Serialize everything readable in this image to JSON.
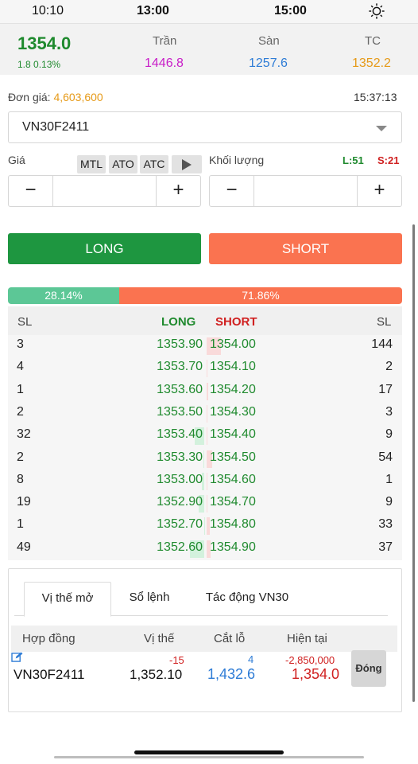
{
  "timebar": {
    "time_1": "10:10",
    "time_2": "13:00",
    "time_3": "15:00",
    "settings_icon": "gear-icon"
  },
  "price_header": {
    "current_price": "1354.0",
    "change": "1.8 0.13%",
    "ceiling_label": "Trần",
    "ceiling_value": "1446.8",
    "floor_label": "Sàn",
    "floor_value": "1257.6",
    "reference_label": "TC",
    "reference_value": "1352.2",
    "colors": {
      "up": "#1f8a2e",
      "ceiling": "#c81ec8",
      "floor": "#2e7cd6",
      "reference": "#e69a18"
    }
  },
  "order": {
    "unit_price_label": "Đơn giá:",
    "unit_price_value": "4,603,600",
    "clock": "15:37:13",
    "contract": "VN30F2411",
    "price_label": "Giá",
    "order_types": [
      "MTL",
      "ATO",
      "ATC"
    ],
    "play_icon": "play-icon",
    "qty_label": "Khối lượng",
    "long_limit": "L:51",
    "short_limit": "S:21",
    "minus": "−",
    "plus": "+",
    "price_value": "",
    "qty_value": "",
    "long_button": "LONG",
    "short_button": "SHORT",
    "colors": {
      "long": "#1e9640",
      "short": "#fa7350"
    }
  },
  "ratio": {
    "long_pct": "28.14%",
    "short_pct": "71.86%",
    "long_fraction": 0.2814
  },
  "orderbook": {
    "headers": {
      "qty_left": "SL",
      "long": "LONG",
      "short": "SHORT",
      "qty_right": "SL"
    },
    "rows": [
      {
        "bid_qty": "3",
        "bid_price": "1353.90",
        "ask_price": "1354.00",
        "ask_qty": "144",
        "bid_level": 0.0,
        "ask_level": 1.0
      },
      {
        "bid_qty": "4",
        "bid_price": "1353.70",
        "ask_price": "1354.10",
        "ask_qty": "2",
        "bid_level": 0.0,
        "ask_level": 0.05
      },
      {
        "bid_qty": "1",
        "bid_price": "1353.60",
        "ask_price": "1354.20",
        "ask_qty": "17",
        "bid_level": 0.0,
        "ask_level": 0.12
      },
      {
        "bid_qty": "2",
        "bid_price": "1353.50",
        "ask_price": "1354.30",
        "ask_qty": "3",
        "bid_level": 0.0,
        "ask_level": 0.05
      },
      {
        "bid_qty": "32",
        "bid_price": "1353.40",
        "ask_price": "1354.40",
        "ask_qty": "9",
        "bid_level": 0.65,
        "ask_level": 0.06
      },
      {
        "bid_qty": "2",
        "bid_price": "1353.30",
        "ask_price": "1354.50",
        "ask_qty": "54",
        "bid_level": 0.05,
        "ask_level": 0.38
      },
      {
        "bid_qty": "8",
        "bid_price": "1353.00",
        "ask_price": "1354.60",
        "ask_qty": "1",
        "bid_level": 0.16,
        "ask_level": 0.02
      },
      {
        "bid_qty": "19",
        "bid_price": "1352.90",
        "ask_price": "1354.70",
        "ask_qty": "9",
        "bid_level": 0.39,
        "ask_level": 0.06
      },
      {
        "bid_qty": "1",
        "bid_price": "1352.70",
        "ask_price": "1354.80",
        "ask_qty": "33",
        "bid_level": 0.02,
        "ask_level": 0.23
      },
      {
        "bid_qty": "49",
        "bid_price": "1352.60",
        "ask_price": "1354.90",
        "ask_qty": "37",
        "bid_level": 1.0,
        "ask_level": 0.26
      }
    ]
  },
  "positions": {
    "tabs": [
      "Vị thế mở",
      "Sổ lệnh",
      "Tác động VN30"
    ],
    "active_tab": 0,
    "headers": {
      "contract": "Hợp đồng",
      "position": "Vị thế",
      "cut_loss": "Cắt lỗ",
      "current": "Hiện tại"
    },
    "row": {
      "contract": "VN30F2411",
      "qty": "-15",
      "price": "1,352.10",
      "cut_count": "4",
      "cut_price": "1,432.6",
      "pnl": "-2,850,000",
      "current": "1,354.0",
      "close_button": "Đóng",
      "edit_icon": "edit-icon"
    }
  }
}
